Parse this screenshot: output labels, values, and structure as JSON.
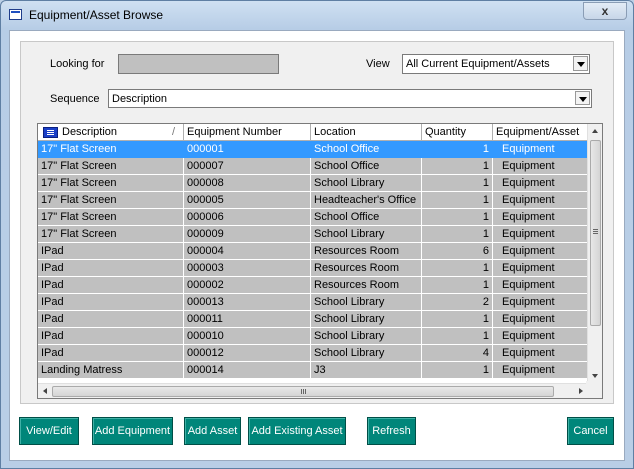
{
  "window": {
    "title": "Equipment/Asset Browse",
    "close_label": "x"
  },
  "filters": {
    "looking_for_label": "Looking for",
    "looking_for_value": "",
    "view_label": "View",
    "view_value": "All Current Equipment/Assets",
    "sequence_label": "Sequence",
    "sequence_value": "Description"
  },
  "table": {
    "columns": [
      "Description",
      "Equipment Number",
      "Location",
      "Quantity",
      "Equipment/Asset"
    ],
    "rows": [
      {
        "description": "17\" Flat Screen",
        "number": "000001",
        "location": "School Office",
        "quantity": "1",
        "type": "Equipment"
      },
      {
        "description": "17\" Flat Screen",
        "number": "000007",
        "location": "School Office",
        "quantity": "1",
        "type": "Equipment"
      },
      {
        "description": "17\" Flat Screen",
        "number": "000008",
        "location": "School Library",
        "quantity": "1",
        "type": "Equipment"
      },
      {
        "description": "17\" Flat Screen",
        "number": "000005",
        "location": "Headteacher's Office",
        "quantity": "1",
        "type": "Equipment"
      },
      {
        "description": "17\" Flat Screen",
        "number": "000006",
        "location": "School Office",
        "quantity": "1",
        "type": "Equipment"
      },
      {
        "description": "17\" Flat Screen",
        "number": "000009",
        "location": "School Library",
        "quantity": "1",
        "type": "Equipment"
      },
      {
        "description": "IPad",
        "number": "000004",
        "location": "Resources Room",
        "quantity": "6",
        "type": "Equipment"
      },
      {
        "description": "IPad",
        "number": "000003",
        "location": "Resources Room",
        "quantity": "1",
        "type": "Equipment"
      },
      {
        "description": "IPad",
        "number": "000002",
        "location": "Resources Room",
        "quantity": "1",
        "type": "Equipment"
      },
      {
        "description": "IPad",
        "number": "000013",
        "location": "School Library",
        "quantity": "2",
        "type": "Equipment"
      },
      {
        "description": "IPad",
        "number": "000011",
        "location": "School Library",
        "quantity": "1",
        "type": "Equipment"
      },
      {
        "description": "IPad",
        "number": "000010",
        "location": "School Library",
        "quantity": "1",
        "type": "Equipment"
      },
      {
        "description": "IPad",
        "number": "000012",
        "location": "School Library",
        "quantity": "4",
        "type": "Equipment"
      },
      {
        "description": "Landing Matress",
        "number": "000014",
        "location": "J3",
        "quantity": "1",
        "type": "Equipment"
      }
    ]
  },
  "buttons": {
    "view_edit": "View/Edit",
    "add_equipment": "Add Equipment",
    "add_asset": "Add Asset",
    "add_existing_asset": "Add Existing Asset",
    "refresh": "Refresh",
    "cancel": "Cancel"
  },
  "colors": {
    "selection": "#3399ff",
    "button": "#00867a",
    "row_bg": "#c0c0c0"
  }
}
